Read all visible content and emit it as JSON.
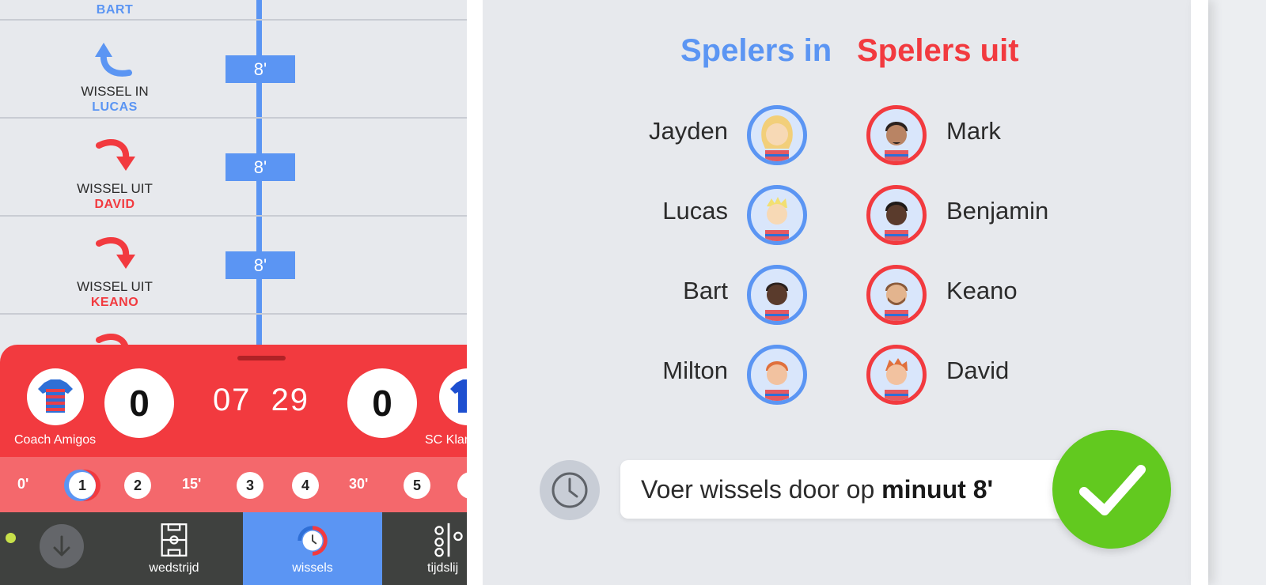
{
  "timeline": {
    "top_name": "BART",
    "events": [
      {
        "type": "WISSEL IN",
        "player": "LUCAS",
        "minute": "8'",
        "direction": "in"
      },
      {
        "type": "WISSEL UIT",
        "player": "DAVID",
        "minute": "8'",
        "direction": "out"
      },
      {
        "type": "WISSEL UIT",
        "player": "KEANO",
        "minute": "8'",
        "direction": "out"
      }
    ]
  },
  "scoreboard": {
    "home_team": "Coach Amigos",
    "home_score": "0",
    "clock_minutes": "07",
    "clock_seconds": "29",
    "away_score": "0",
    "away_team": "SC Klar"
  },
  "periods": [
    {
      "kind": "minute",
      "label": "0'"
    },
    {
      "kind": "period",
      "label": "1",
      "active": true
    },
    {
      "kind": "period",
      "label": "2"
    },
    {
      "kind": "minute",
      "label": "15'"
    },
    {
      "kind": "period",
      "label": "3"
    },
    {
      "kind": "period",
      "label": "4"
    },
    {
      "kind": "minute",
      "label": "30'"
    },
    {
      "kind": "period",
      "label": "5"
    }
  ],
  "tabs": [
    {
      "label": "",
      "icon": "arrow-down-icon"
    },
    {
      "label": "wedstrijd",
      "icon": "field-icon"
    },
    {
      "label": "wissels",
      "icon": "substitution-clock-icon",
      "active": true
    },
    {
      "label": "tijdslij",
      "icon": "timeline-icon"
    }
  ],
  "substitutions": {
    "in_title": "Spelers in",
    "out_title": "Spelers uit",
    "players_in": [
      "Jayden",
      "Lucas",
      "Bart",
      "Milton"
    ],
    "players_out": [
      "Mark",
      "Benjamin",
      "Keano",
      "David"
    ]
  },
  "confirm": {
    "text_prefix": "Voer wissels door op ",
    "text_bold": "minuut 8'"
  },
  "colors": {
    "blue": "#5b95f3",
    "red": "#f23a3f",
    "green": "#62c91f",
    "tabbar": "#3f413f"
  }
}
